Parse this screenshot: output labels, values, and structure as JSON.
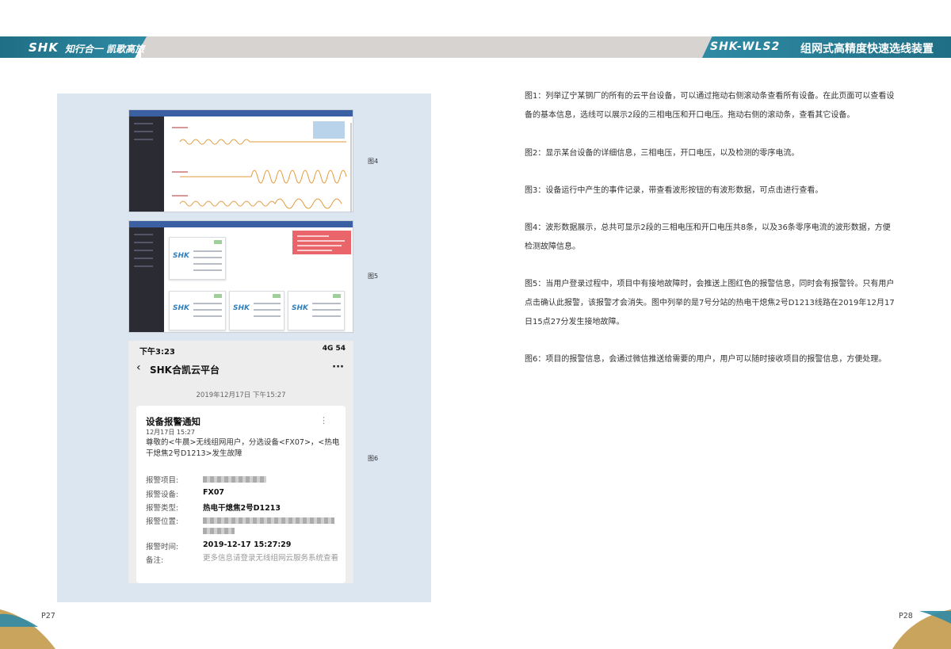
{
  "header": {
    "left_logo": "SHK",
    "left_slogan": "知行合一 凯歌高旅",
    "right_logo": "SHK-WLS2",
    "right_title": "组网式高精度快速选线装置"
  },
  "figures": {
    "fig4_label": "图4",
    "fig5_label": "图5",
    "fig6_label": "图6",
    "fig4_card_logo": "SHK",
    "fig5_card_logo": "SHK"
  },
  "phone": {
    "status_time": "下午3:23",
    "network": "4G 54",
    "back_icon": "‹",
    "app_title": "SHK合凯云平台",
    "more_icon": "···",
    "msg_date": "2019年12月17日 下午15:27",
    "card_title": "设备报警通知",
    "card_time": "12月17日 15:27",
    "card_dots": "⋮",
    "card_message": "尊敬的<牛晨>无线组网用户，分选设备<FX07>，<热电干熄焦2号D1213>发生故障",
    "rows": [
      {
        "label": "报警项目:",
        "value": ""
      },
      {
        "label": "报警设备:",
        "value": "FX07"
      },
      {
        "label": "报警类型:",
        "value": "热电干熄焦2号D1213"
      },
      {
        "label": "报警位置:",
        "value": ""
      },
      {
        "label": "报警时间:",
        "value": "2019-12-17 15:27:29"
      },
      {
        "label": "备注:",
        "value": "更多信息请登录无线组网云服务系统查看"
      }
    ]
  },
  "paragraphs": [
    "图1：列举辽宁某钢厂的所有的云平台设备，可以通过拖动右侧滚动条查看所有设备。在此页面可以查看设备的基本信息，选线可以展示2段的三相电压和开口电压。拖动右侧的滚动条，查看其它设备。",
    "图2：显示某台设备的详细信息，三相电压，开口电压，以及检测的零序电流。",
    "图3：设备运行中产生的事件记录，带查看波形按钮的有波形数据，可点击进行查看。",
    "图4：波形数据展示，总共可显示2段的三相电压和开口电压共8条，以及36条零序电流的波形数据，方便检测故障信息。",
    "图5：当用户登录过程中，项目中有接地故障时，会推送上图红色的报警信息，同时会有报警铃。只有用户点击确认此报警，该报警才会消失。图中列举的是7号分站的热电干熄焦2号D1213线路在2019年12月17日15点27分发生接地故障。",
    "图6：项目的报警信息，会通过微信推送给需要的用户，用户可以随时接收项目的报警信息，方便处理。"
  ],
  "footer": {
    "left_page": "P27",
    "right_page": "P28"
  },
  "colors": {
    "header_teal": "#1f6f86",
    "header_grey": "#d6d3d0",
    "panel_bg": "#dce6f1",
    "wave_orange": "#e39a3b",
    "alarm_red": "#e9656a",
    "corner_gold": "#c9a45c"
  }
}
